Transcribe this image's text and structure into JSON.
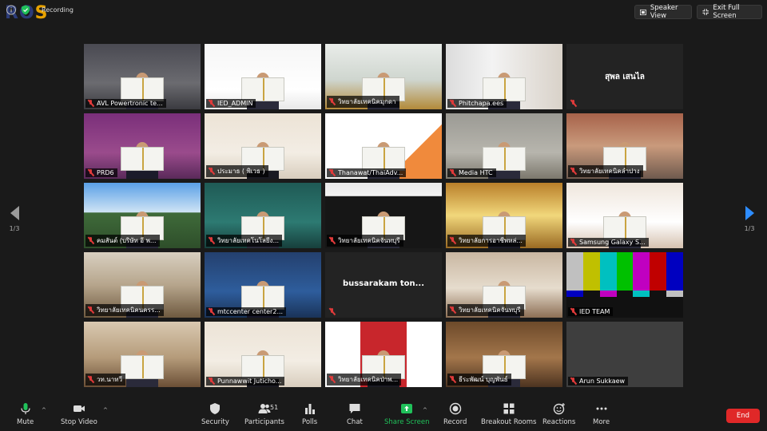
{
  "topbar": {
    "recording_label": "Recording",
    "speaker_view_label": "Speaker View",
    "exit_full_screen_label": "Exit Full Screen"
  },
  "page_indicator": {
    "left": "1/3",
    "right": "1/3"
  },
  "tiles": [
    {
      "name": "AVL Powertronic te...",
      "scene": "office"
    },
    {
      "name": "IED_ADMIN",
      "scene": "banner",
      "active": true
    },
    {
      "name": "วิทยาลัยเทคนิคมุกดา",
      "scene": "room"
    },
    {
      "name": "Phitchapa.ees",
      "scene": "window"
    },
    {
      "name": "",
      "center_text": "สุพล เสนไล",
      "scene": "blank"
    },
    {
      "name": "PRD6",
      "scene": "purple"
    },
    {
      "name": "ประมาธ ( พิเวธ )",
      "scene": "cream"
    },
    {
      "name": "Thanawat/ThaiAdv...",
      "scene": "brand"
    },
    {
      "name": "Media HTC",
      "scene": "gray"
    },
    {
      "name": "วิทยาลัยเทคนิคลำปาง",
      "scene": "hall"
    },
    {
      "name": "คมสันต์ (บริษัท อี พ...",
      "scene": "solar"
    },
    {
      "name": "วิทยาลัยเทคโนโลยีง...",
      "scene": "teal"
    },
    {
      "name": "วิทยาลัยเทคนิคจันทบุรี",
      "scene": "dark"
    },
    {
      "name": "วิทยาลัยการอาชีพหล่...",
      "scene": "gold"
    },
    {
      "name": "Samsung Galaxy S...",
      "scene": "ceremony"
    },
    {
      "name": "วิทยาลัยเทคนิคนครร...",
      "scene": "hall2"
    },
    {
      "name": "mtccenter center2...",
      "scene": "blue"
    },
    {
      "name": "",
      "center_text": "bussarakam ton...",
      "scene": "blank"
    },
    {
      "name": "วิทยาลัยเทคนิคจันทบุรี",
      "scene": "shelf"
    },
    {
      "name": "IED TEAM",
      "scene": "colorbars"
    },
    {
      "name": "วท.นาทวี",
      "scene": "meeting"
    },
    {
      "name": "Punnawwit Juticho...",
      "scene": "cream"
    },
    {
      "name": "วิทยาลัยเทคนิคป่าพ...",
      "scene": "red"
    },
    {
      "name": "ธีระพัฒน์ บุญพันธ์",
      "scene": "wood"
    },
    {
      "name": "Arun Sukkaew",
      "scene": "plain"
    }
  ],
  "toolbar": {
    "mute": "Mute",
    "stop_video": "Stop Video",
    "security": "Security",
    "participants": "Participants",
    "participants_count": "51",
    "polls": "Polls",
    "chat": "Chat",
    "share_screen": "Share Screen",
    "record": "Record",
    "breakout_rooms": "Breakout Rooms",
    "reactions": "Reactions",
    "more": "More",
    "end": "End"
  },
  "colors": {
    "accent_green": "#20c15a",
    "end_red": "#e02828",
    "active_outline": "#c8e64a",
    "nav_blue": "#2d8cff"
  }
}
